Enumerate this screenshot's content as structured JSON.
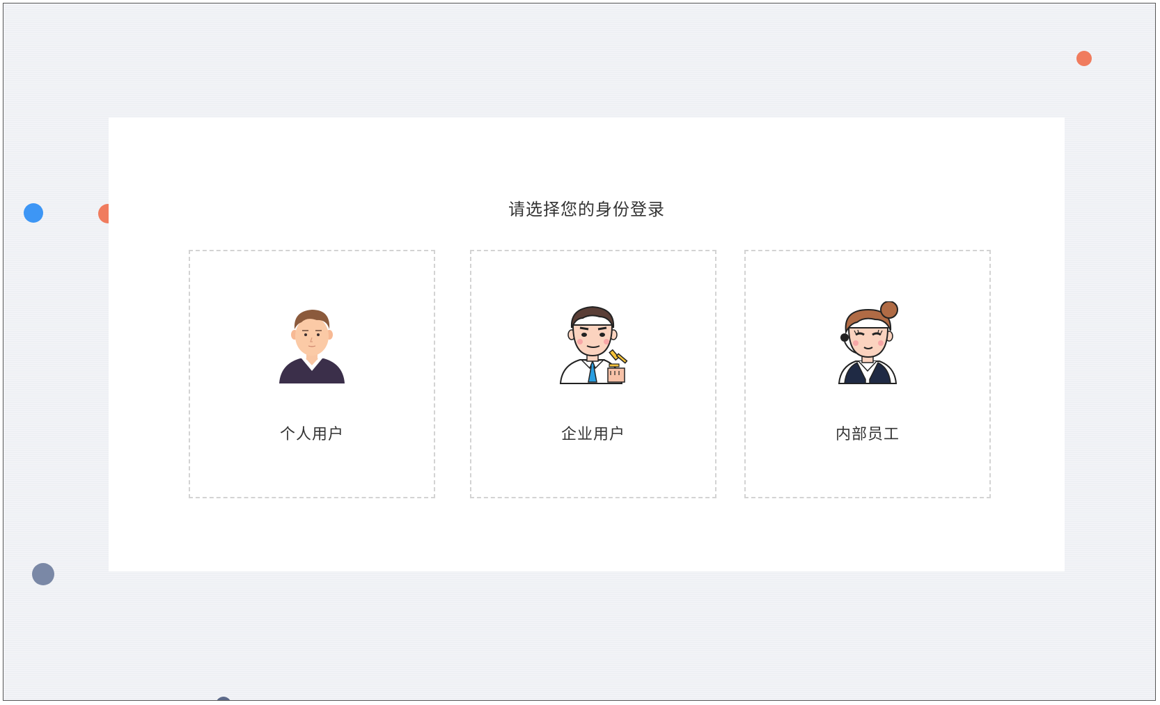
{
  "page": {
    "title": "请选择您的身份登录"
  },
  "options": [
    {
      "label": "个人用户",
      "icon": "personal-user-avatar-icon"
    },
    {
      "label": "企业用户",
      "icon": "enterprise-user-avatar-icon"
    },
    {
      "label": "内部员工",
      "icon": "internal-staff-avatar-icon"
    }
  ],
  "colors": {
    "background": "#eef0f4",
    "card": "#ffffff",
    "dashed_border": "#d3d3d3",
    "dot_orange": "#f07c5e",
    "dot_blue": "#3d96f5",
    "dot_slate": "#7a88a6",
    "dot_navy": "#5d6a8a",
    "text": "#333333"
  }
}
